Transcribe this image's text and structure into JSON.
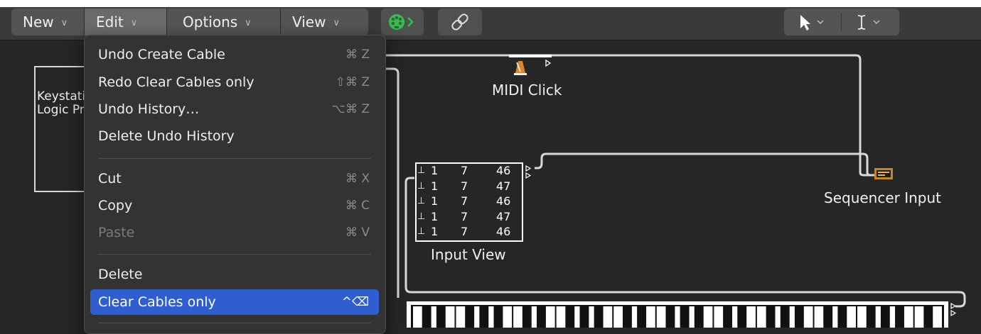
{
  "toolbar": {
    "new_label": "New",
    "edit_label": "Edit",
    "options_label": "Options",
    "view_label": "View",
    "midi_button_icon": "midi-plug-icon",
    "link_button_icon": "link-icon",
    "pointer_tool_icon": "pointer-arrow-icon",
    "text_tool_icon": "text-cursor-icon",
    "accent_green": "#2ec24a"
  },
  "edit_menu": {
    "items": [
      {
        "label": "Undo Create Cable",
        "shortcut": "⌘ Z"
      },
      {
        "label": "Redo Clear Cables only",
        "shortcut": "⇧⌘ Z"
      },
      {
        "label": "Undo History…",
        "shortcut": "⌥⌘ Z"
      },
      {
        "label": "Delete Undo History",
        "shortcut": ""
      },
      {
        "label": "Cut",
        "shortcut": "⌘ X"
      },
      {
        "label": "Copy",
        "shortcut": "⌘ C"
      },
      {
        "label": "Paste",
        "shortcut": "⌘ V",
        "disabled": true
      },
      {
        "label": "Delete",
        "shortcut": ""
      },
      {
        "label": "Clear Cables only",
        "shortcut": "^⌫",
        "highlighted": true
      }
    ],
    "highlight_color": "#2f5ed0"
  },
  "canvas": {
    "left_box_text_1": "Keystation",
    "left_box_text_2": "Logic Pro",
    "midi_click_label": "MIDI Click",
    "sequencer_input_label": "Sequencer Input",
    "input_view_label": "Input View",
    "input_view_rows": [
      {
        "ch": "1",
        "num": "7",
        "val": "46"
      },
      {
        "ch": "1",
        "num": "7",
        "val": "47"
      },
      {
        "ch": "1",
        "num": "7",
        "val": "46"
      },
      {
        "ch": "1",
        "num": "7",
        "val": "47"
      },
      {
        "ch": "1",
        "num": "7",
        "val": "46"
      }
    ]
  }
}
